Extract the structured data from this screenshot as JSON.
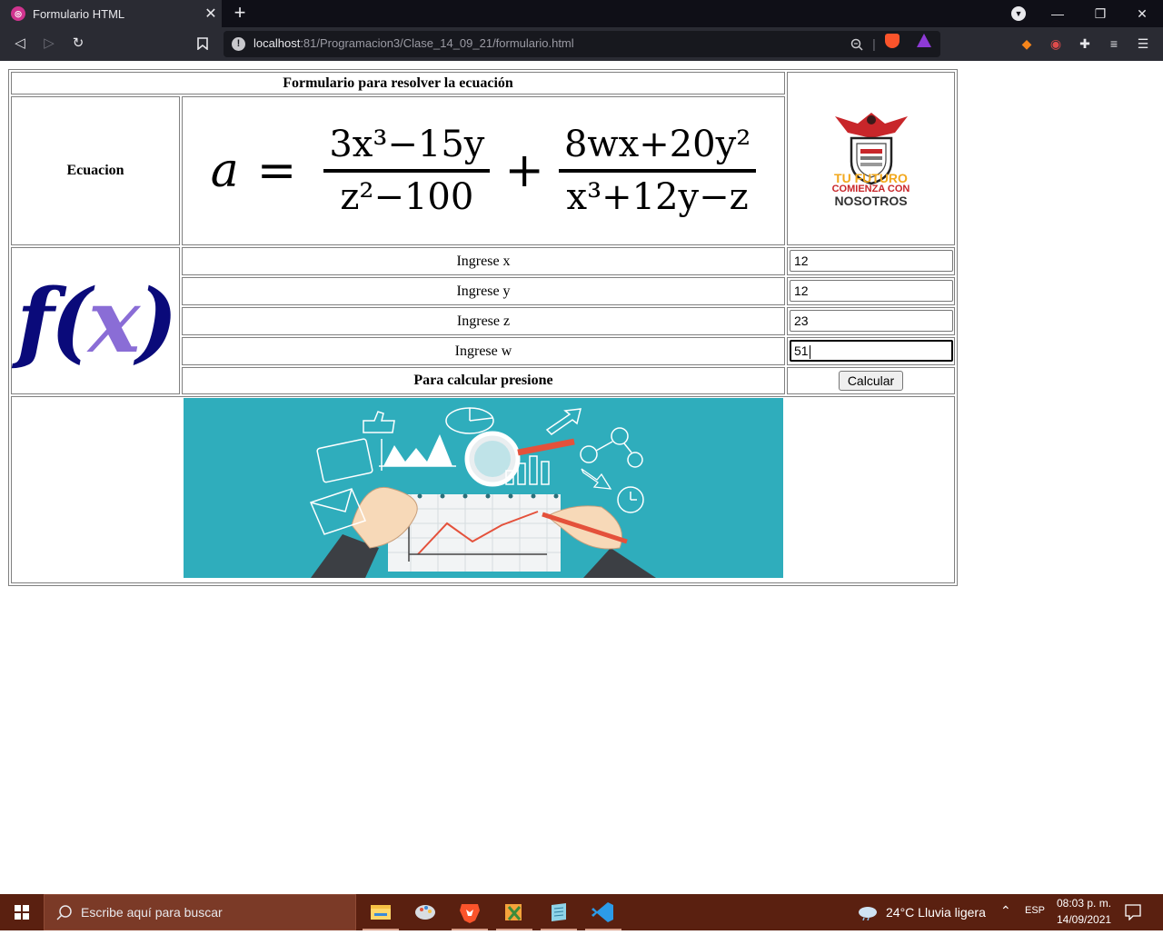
{
  "browser": {
    "tab_title": "Formulario HTML",
    "tab_close": "✕",
    "new_tab": "+",
    "url_host": "localhost",
    "url_path": ":81/Programacion3/Clase_14_09_21/formulario.html"
  },
  "form": {
    "header": "Formulario para resolver la ecuación",
    "equation_label": "Ecuacion",
    "equation": {
      "lhs": "a",
      "eq": "=",
      "frac1_num": "3x³−15y",
      "frac1_den": "z²−100",
      "plus": "+",
      "frac2_num": "8wx+20y²",
      "frac2_den": "x³+12y−z"
    },
    "logo": {
      "line1": "TU FUTURO",
      "line2": "COMIENZA CON",
      "line3": "NOSOTROS"
    },
    "fx_label": "f(x)",
    "rows": [
      {
        "label": "Ingrese x",
        "value": "12"
      },
      {
        "label": "Ingrese y",
        "value": "12"
      },
      {
        "label": "Ingrese z",
        "value": "23"
      },
      {
        "label": "Ingrese w",
        "value": "51"
      }
    ],
    "submit_label": "Para calcular presione",
    "submit_button": "Calcular"
  },
  "taskbar": {
    "search_placeholder": "Escribe aquí para buscar",
    "weather": "24°C  Lluvia ligera",
    "language": "ESP",
    "time": "08:03 p. m.",
    "date": "14/09/2021"
  },
  "colors": {
    "illustration_bg": "#2fadbc",
    "taskbar": "#5a2010",
    "chrome_dark": "#0f0f17",
    "toolbar": "#2a2b33"
  }
}
